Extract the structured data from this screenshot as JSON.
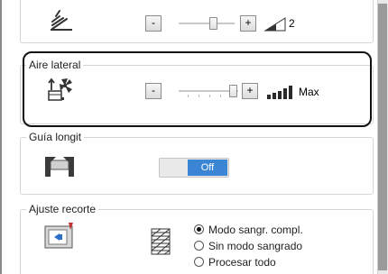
{
  "top_row": {
    "minus_label": "-",
    "plus_label": "+",
    "level": "2",
    "slider_fraction": 0.6
  },
  "aire_lateral": {
    "title": "Aire lateral",
    "minus_label": "-",
    "plus_label": "+",
    "level": "Max",
    "slider_fraction": 1.0
  },
  "guia_longit": {
    "title": "Guía longit",
    "toggle_value": "Off"
  },
  "ajuste_recorte": {
    "title": "Ajuste recorte",
    "options": [
      {
        "label": "Modo sangr. compl.",
        "checked": true
      },
      {
        "label": "Sin modo sangrado",
        "checked": false
      },
      {
        "label": "Procesar todo",
        "checked": false
      }
    ]
  },
  "colors": {
    "accent": "#3a86d4",
    "icon_blue": "#2e6fc8"
  }
}
